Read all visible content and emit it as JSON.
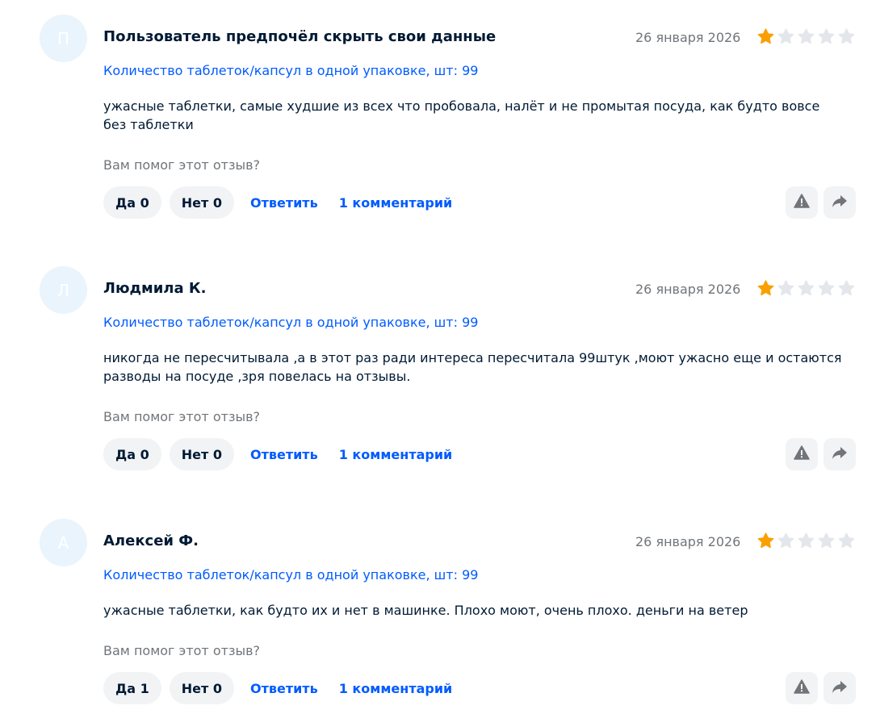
{
  "colors": {
    "accent": "#005bff",
    "star_filled": "#f9a000",
    "star_empty": "#e3e6ea",
    "muted": "#70757a"
  },
  "helpful_prompt": "Вам помог этот отзыв?",
  "reply_label": "Ответить",
  "reviews": [
    {
      "avatar_letter": "П",
      "author": "Пользователь предпочёл скрыть свои данные",
      "date": "26 января 2026",
      "rating": 1,
      "param": "Количество таблеток/капсул в одной упаковке, шт: 99",
      "text": "ужасные таблетки, самые худшие из всех что пробовала, налёт и не промытая посуда, как будто вовсе без таблетки",
      "yes_label": "Да 0",
      "no_label": "Нет 0",
      "comments_label": "1 комментарий"
    },
    {
      "avatar_letter": "Л",
      "author": "Людмила К.",
      "date": "26 января 2026",
      "rating": 1,
      "param": "Количество таблеток/капсул в одной упаковке, шт: 99",
      "text": "никогда не пересчитывала ,а в этот раз ради интереса пересчитала 99штук ,моют ужасно еще и остаются разводы на посуде ,зря повелась на отзывы.",
      "yes_label": "Да 0",
      "no_label": "Нет 0",
      "comments_label": "1 комментарий"
    },
    {
      "avatar_letter": "А",
      "author": "Алексей Ф.",
      "date": "26 января 2026",
      "rating": 1,
      "param": "Количество таблеток/капсул в одной упаковке, шт: 99",
      "text": "ужасные таблетки, как будто их и нет в машинке. Плохо моют, очень плохо. деньги на ветер",
      "yes_label": "Да 1",
      "no_label": "Нет 0",
      "comments_label": "1 комментарий"
    }
  ]
}
